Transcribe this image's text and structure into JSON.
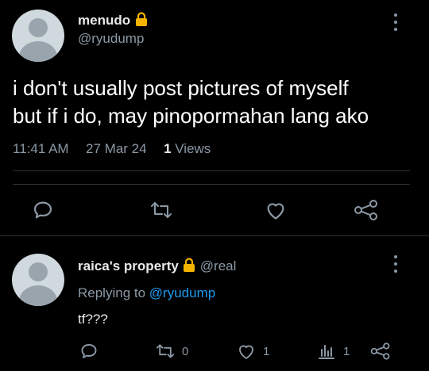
{
  "tweet": {
    "author_name": "menudo",
    "author_handle": "@ryudump",
    "text_line1": "i don't usually post pictures of myself",
    "text_line2": "but if i do, may pinopormahan lang ako",
    "time": "11:41 AM",
    "date": "27 Mar 24",
    "views_count": "1",
    "views_label": "Views"
  },
  "reply": {
    "author_name": "raica's property",
    "author_handle": "@real",
    "replying_prefix": "Replying to",
    "replying_handle": "@ryudump",
    "text": "tf???",
    "retweet_count": "0",
    "like_count": "1",
    "views_count": "1"
  },
  "icons": {
    "lock": "lock-icon",
    "reply": "speech-bubble-icon",
    "retweet": "retweet-arrows-icon",
    "like": "heart-icon",
    "share": "share-icon",
    "views": "bar-chart-icon",
    "more": "vertical-dots-icon"
  },
  "colors": {
    "background": "#000000",
    "text": "#e7e9ea",
    "muted": "#8b98a5",
    "accent": "#1d9bf0",
    "lock": "#f4b400"
  }
}
